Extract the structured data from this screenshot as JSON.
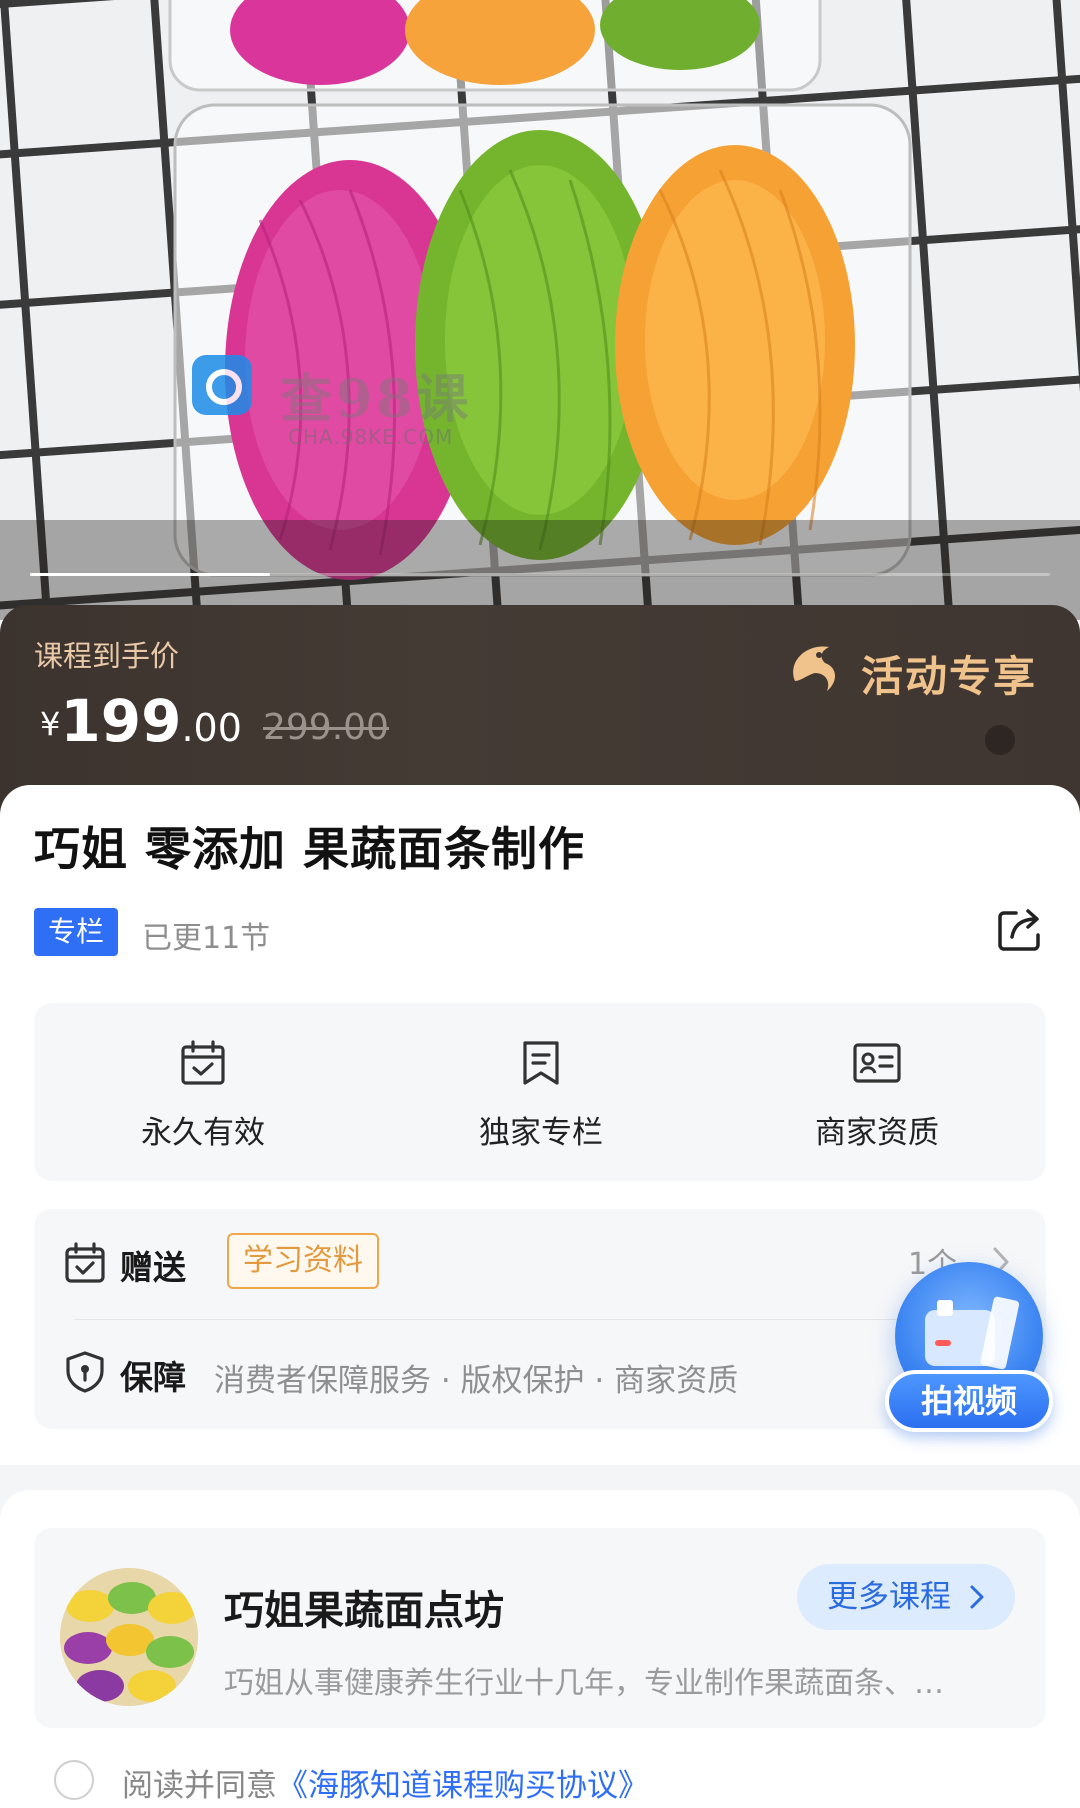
{
  "hero": {
    "watermark_main": "查98课",
    "watermark_sub": "CHA.98KE.COM"
  },
  "price": {
    "label": "课程到手价",
    "currency": "¥",
    "current_int": "199",
    "current_dec": ".00",
    "original": "299.00",
    "promo_text": "活动专享"
  },
  "course": {
    "title": "巧姐 零添加 果蔬面条制作",
    "badge": "专栏",
    "updated": "已更11节"
  },
  "features": [
    {
      "label": "永久有效",
      "icon": "calendar-check-icon"
    },
    {
      "label": "独家专栏",
      "icon": "bookmark-icon"
    },
    {
      "label": "商家资质",
      "icon": "id-card-icon"
    }
  ],
  "benefits": {
    "gift_title": "赠送",
    "gift_tag": "学习资料",
    "gift_count": "1个",
    "guarantee_title": "保障",
    "guarantee_text": "消费者保障服务 · 版权保护 · 商家资质"
  },
  "fab": {
    "label": "拍视频"
  },
  "shop": {
    "name": "巧姐果蔬面点坊",
    "more_label": "更多课程",
    "description": "巧姐从事健康养生行业十几年，专业制作果蔬面条、…"
  },
  "agreement": {
    "prefix": "阅读并同意",
    "link": "《海豚知道课程购买协议》"
  },
  "colors": {
    "accent_blue": "#2f6ff5",
    "gold": "#f0c28c",
    "banner_brown": "#3f3631",
    "gift_orange": "#e39a3f"
  }
}
